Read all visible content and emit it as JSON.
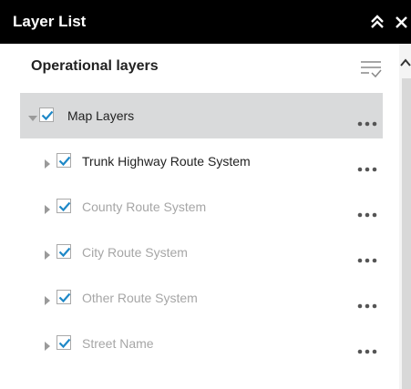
{
  "window": {
    "title": "Layer List",
    "collapse_icon": "double-chevron-up-icon",
    "close_icon": "close-icon"
  },
  "header": {
    "label": "Operational layers",
    "filter_icon": "layer-filter-icon"
  },
  "colors": {
    "titlebar_bg": "#000000",
    "selected_row_bg": "#d9dadb",
    "checkbox_check": "#1e88c7",
    "text_dark": "#222222",
    "text_muted": "#a6a6a6"
  },
  "layers": [
    {
      "label": "Map Layers",
      "checked": true,
      "expanded": true,
      "level": 0,
      "selected": true,
      "muted": false
    },
    {
      "label": "Trunk Highway Route System",
      "checked": true,
      "expanded": false,
      "level": 1,
      "selected": false,
      "muted": false
    },
    {
      "label": "County Route System",
      "checked": true,
      "expanded": false,
      "level": 1,
      "selected": false,
      "muted": true
    },
    {
      "label": "City Route System",
      "checked": true,
      "expanded": false,
      "level": 1,
      "selected": false,
      "muted": true
    },
    {
      "label": "Other Route System",
      "checked": true,
      "expanded": false,
      "level": 1,
      "selected": false,
      "muted": true
    },
    {
      "label": "Street Name",
      "checked": true,
      "expanded": false,
      "level": 1,
      "selected": false,
      "muted": true
    }
  ]
}
